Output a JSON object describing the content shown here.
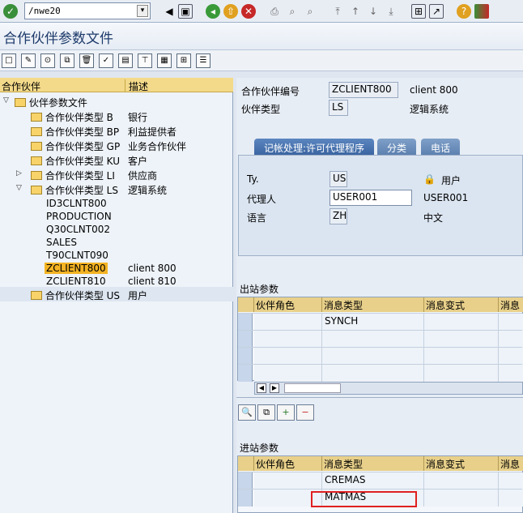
{
  "command": {
    "value": "/nwe20",
    "history_icon": "command-history-icon"
  },
  "title": "合作伙伴参数文件",
  "left": {
    "headers": [
      "合作伙伴",
      "描述"
    ],
    "root": "伙伴参数文件",
    "types": [
      {
        "label": "合作伙伴类型 B",
        "desc": "银行"
      },
      {
        "label": "合作伙伴类型 BP",
        "desc": "利益提供者"
      },
      {
        "label": "合作伙伴类型 GP",
        "desc": "业务合作伙伴"
      },
      {
        "label": "合作伙伴类型 KU",
        "desc": "客户"
      },
      {
        "label": "合作伙伴类型 LI",
        "desc": "供应商"
      },
      {
        "label": "合作伙伴类型 LS",
        "desc": "逻辑系统"
      }
    ],
    "ls_children": [
      {
        "label": "ID3CLNT800",
        "desc": ""
      },
      {
        "label": "PRODUCTION",
        "desc": ""
      },
      {
        "label": "Q30CLNT002",
        "desc": ""
      },
      {
        "label": "SALES",
        "desc": ""
      },
      {
        "label": "T90CLNT090",
        "desc": ""
      },
      {
        "label": "ZCLIENT800",
        "desc": "client 800"
      },
      {
        "label": "ZCLIENT810",
        "desc": "client 810"
      }
    ],
    "last_type": {
      "label": "合作伙伴类型 US",
      "desc": "用户"
    }
  },
  "header": {
    "partner_no_label": "合作伙伴编号",
    "partner_no": "ZCLIENT800",
    "partner_no_desc": "client 800",
    "partner_type_label": "伙伴类型",
    "partner_type": "LS",
    "partner_type_desc": "逻辑系统"
  },
  "tabs": [
    "记帐处理:许可代理程序",
    "分类",
    "电话"
  ],
  "tab_fields": {
    "ty_label": "Ty.",
    "ty": "US",
    "ty_desc": "用户",
    "agent_label": "代理人",
    "agent": "USER001",
    "agent_desc": "USER001",
    "lang_label": "语言",
    "lang": "ZH",
    "lang_desc": "中文"
  },
  "outbound": {
    "title": "出站参数",
    "cols": [
      "伙伴角色",
      "消息类型",
      "消息变式",
      "消息"
    ],
    "rows": [
      [
        "",
        "SYNCH",
        "",
        ""
      ],
      [
        "",
        "",
        "",
        ""
      ],
      [
        "",
        "",
        "",
        ""
      ],
      [
        "",
        "",
        "",
        ""
      ]
    ]
  },
  "inbound": {
    "title": "进站参数",
    "cols": [
      "伙伴角色",
      "消息类型",
      "消息变式",
      "消息"
    ],
    "rows": [
      [
        "",
        "CREMAS",
        "",
        ""
      ],
      [
        "",
        "MATMAS",
        "",
        ""
      ]
    ]
  }
}
